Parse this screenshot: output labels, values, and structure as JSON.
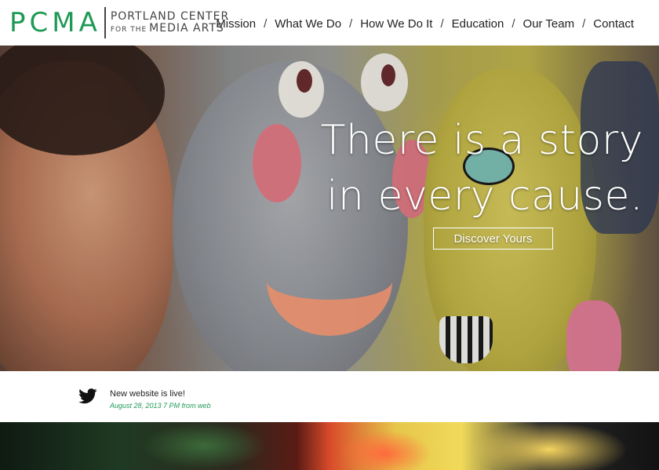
{
  "brand": {
    "mark": "PCMA",
    "line1": "PORTLAND CENTER",
    "line2_small": "FOR THE",
    "line2_large": "MEDIA ARTS",
    "accent_color": "#1f9a55"
  },
  "nav": {
    "items": [
      {
        "label": "Mission"
      },
      {
        "label": "What We Do"
      },
      {
        "label": "How We Do It"
      },
      {
        "label": "Education"
      },
      {
        "label": "Our Team"
      },
      {
        "label": "Contact"
      }
    ],
    "separator": "/"
  },
  "hero": {
    "headline_line1": "There is a story",
    "headline_line2": "in every cause.",
    "cta_label": "Discover Yours"
  },
  "tweet": {
    "icon": "twitter-bird-icon",
    "text": "New website is live!",
    "meta": "August 28, 2013 7 PM from web"
  }
}
